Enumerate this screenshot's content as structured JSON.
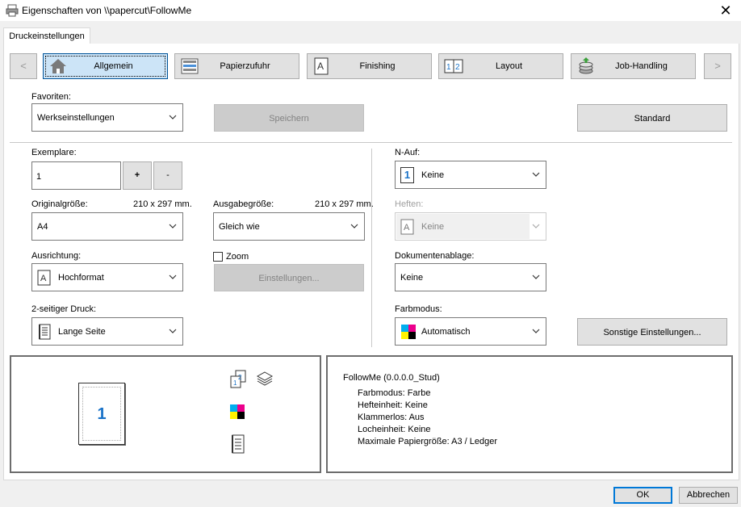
{
  "window": {
    "title": "Eigenschaften von \\\\papercut\\FollowMe",
    "close_glyph": "✕"
  },
  "tabs": [
    "Druckeinstellungen"
  ],
  "nav": {
    "prev": "<",
    "next": ">",
    "items": [
      "Allgemein",
      "Papierzufuhr",
      "Finishing",
      "Layout",
      "Job-Handling"
    ]
  },
  "favorites": {
    "label": "Favoriten:",
    "value": "Werkseinstellungen",
    "save": "Speichern",
    "standard": "Standard"
  },
  "copies": {
    "label": "Exemplare:",
    "value": "1",
    "plus": "+",
    "minus": "-"
  },
  "original_size": {
    "label": "Originalgröße:",
    "dims": "210 x 297 mm.",
    "value": "A4"
  },
  "output_size": {
    "label": "Ausgabegröße:",
    "dims": "210 x 297 mm.",
    "value": "Gleich wie"
  },
  "orientation": {
    "label": "Ausrichtung:",
    "value": "Hochformat"
  },
  "zoom": {
    "label": "Zoom",
    "checked": false,
    "settings": "Einstellungen..."
  },
  "duplex": {
    "label": "2-seitiger Druck:",
    "value": "Lange Seite"
  },
  "n_up": {
    "label": "N-Auf:",
    "value": "Keine",
    "icon_digit": "1"
  },
  "stapling": {
    "label": "Heften:",
    "value": "Keine"
  },
  "document_filing": {
    "label": "Dokumentenablage:",
    "value": "Keine"
  },
  "color_mode": {
    "label": "Farbmodus:",
    "value": "Automatisch",
    "other": "Sonstige Einstellungen..."
  },
  "preview": {
    "page_number": "1"
  },
  "info": {
    "header": "FollowMe (0.0.0.0_Stud)",
    "lines": [
      "Farbmodus: Farbe",
      "Hefteinheit: Keine",
      "Klammerlos: Aus",
      "Locheinheit: Keine",
      "Maximale Papiergröße: A3 / Ledger"
    ]
  },
  "footer": {
    "ok": "OK",
    "cancel": "Abbrechen"
  },
  "colors": {
    "accent_blue": "#1a73c8",
    "active_tab": "#cce4f7",
    "active_border": "#005499"
  }
}
